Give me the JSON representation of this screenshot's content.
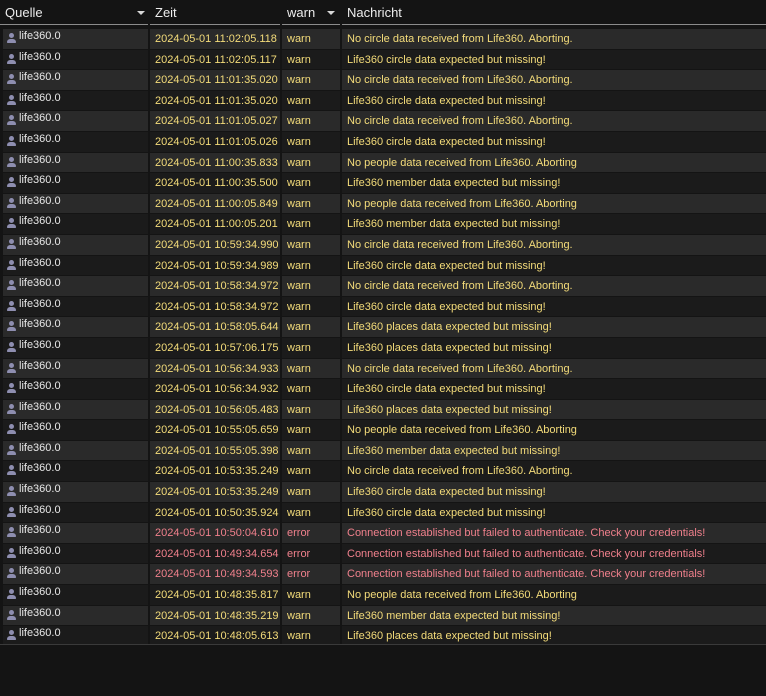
{
  "columns": {
    "source": "Quelle",
    "time": "Zeit",
    "level": "warn",
    "message": "Nachricht"
  },
  "colors": {
    "warn": "#f4dc7a",
    "error": "#f0808c",
    "row_odd": "#2a2a2a",
    "row_even": "#1b1b1b"
  },
  "source_icon": "user-icon",
  "rows": [
    {
      "source": "life360.0",
      "time": "2024-05-01 11:02:05.118",
      "level": "warn",
      "message": "No circle data received from Life360. Aborting."
    },
    {
      "source": "life360.0",
      "time": "2024-05-01 11:02:05.117",
      "level": "warn",
      "message": "Life360 circle data expected but missing!"
    },
    {
      "source": "life360.0",
      "time": "2024-05-01 11:01:35.020",
      "level": "warn",
      "message": "No circle data received from Life360. Aborting."
    },
    {
      "source": "life360.0",
      "time": "2024-05-01 11:01:35.020",
      "level": "warn",
      "message": "Life360 circle data expected but missing!"
    },
    {
      "source": "life360.0",
      "time": "2024-05-01 11:01:05.027",
      "level": "warn",
      "message": "No circle data received from Life360. Aborting."
    },
    {
      "source": "life360.0",
      "time": "2024-05-01 11:01:05.026",
      "level": "warn",
      "message": "Life360 circle data expected but missing!"
    },
    {
      "source": "life360.0",
      "time": "2024-05-01 11:00:35.833",
      "level": "warn",
      "message": "No people data received from Life360. Aborting"
    },
    {
      "source": "life360.0",
      "time": "2024-05-01 11:00:35.500",
      "level": "warn",
      "message": "Life360 member data expected but missing!"
    },
    {
      "source": "life360.0",
      "time": "2024-05-01 11:00:05.849",
      "level": "warn",
      "message": "No people data received from Life360. Aborting"
    },
    {
      "source": "life360.0",
      "time": "2024-05-01 11:00:05.201",
      "level": "warn",
      "message": "Life360 member data expected but missing!"
    },
    {
      "source": "life360.0",
      "time": "2024-05-01 10:59:34.990",
      "level": "warn",
      "message": "No circle data received from Life360. Aborting."
    },
    {
      "source": "life360.0",
      "time": "2024-05-01 10:59:34.989",
      "level": "warn",
      "message": "Life360 circle data expected but missing!"
    },
    {
      "source": "life360.0",
      "time": "2024-05-01 10:58:34.972",
      "level": "warn",
      "message": "No circle data received from Life360. Aborting."
    },
    {
      "source": "life360.0",
      "time": "2024-05-01 10:58:34.972",
      "level": "warn",
      "message": "Life360 circle data expected but missing!"
    },
    {
      "source": "life360.0",
      "time": "2024-05-01 10:58:05.644",
      "level": "warn",
      "message": "Life360 places data expected but missing!"
    },
    {
      "source": "life360.0",
      "time": "2024-05-01 10:57:06.175",
      "level": "warn",
      "message": "Life360 places data expected but missing!"
    },
    {
      "source": "life360.0",
      "time": "2024-05-01 10:56:34.933",
      "level": "warn",
      "message": "No circle data received from Life360. Aborting."
    },
    {
      "source": "life360.0",
      "time": "2024-05-01 10:56:34.932",
      "level": "warn",
      "message": "Life360 circle data expected but missing!"
    },
    {
      "source": "life360.0",
      "time": "2024-05-01 10:56:05.483",
      "level": "warn",
      "message": "Life360 places data expected but missing!"
    },
    {
      "source": "life360.0",
      "time": "2024-05-01 10:55:05.659",
      "level": "warn",
      "message": "No people data received from Life360. Aborting"
    },
    {
      "source": "life360.0",
      "time": "2024-05-01 10:55:05.398",
      "level": "warn",
      "message": "Life360 member data expected but missing!"
    },
    {
      "source": "life360.0",
      "time": "2024-05-01 10:53:35.249",
      "level": "warn",
      "message": "No circle data received from Life360. Aborting."
    },
    {
      "source": "life360.0",
      "time": "2024-05-01 10:53:35.249",
      "level": "warn",
      "message": "Life360 circle data expected but missing!"
    },
    {
      "source": "life360.0",
      "time": "2024-05-01 10:50:35.924",
      "level": "warn",
      "message": "Life360 circle data expected but missing!"
    },
    {
      "source": "life360.0",
      "time": "2024-05-01 10:50:04.610",
      "level": "error",
      "message": "Connection established but failed to authenticate. Check your credentials!"
    },
    {
      "source": "life360.0",
      "time": "2024-05-01 10:49:34.654",
      "level": "error",
      "message": "Connection established but failed to authenticate. Check your credentials!"
    },
    {
      "source": "life360.0",
      "time": "2024-05-01 10:49:34.593",
      "level": "error",
      "message": "Connection established but failed to authenticate. Check your credentials!"
    },
    {
      "source": "life360.0",
      "time": "2024-05-01 10:48:35.817",
      "level": "warn",
      "message": "No people data received from Life360. Aborting"
    },
    {
      "source": "life360.0",
      "time": "2024-05-01 10:48:35.219",
      "level": "warn",
      "message": "Life360 member data expected but missing!"
    },
    {
      "source": "life360.0",
      "time": "2024-05-01 10:48:05.613",
      "level": "warn",
      "message": "Life360 places data expected but missing!"
    }
  ]
}
